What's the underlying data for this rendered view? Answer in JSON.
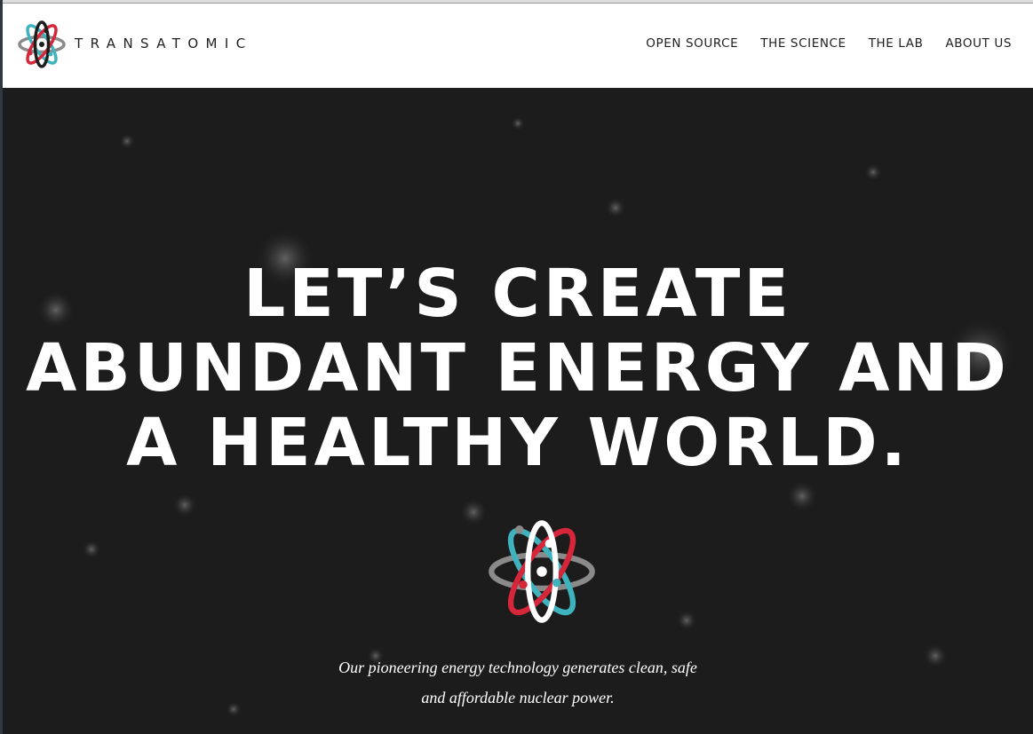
{
  "header": {
    "brand": "TRANSATOMIC",
    "nav": [
      {
        "label": "OPEN SOURCE"
      },
      {
        "label": "THE SCIENCE"
      },
      {
        "label": "THE LAB"
      },
      {
        "label": "ABOUT US"
      }
    ]
  },
  "hero": {
    "headline": [
      "LET’S CREATE",
      "ABUNDANT ENERGY AND",
      "A HEALTHY WORLD."
    ],
    "tagline": [
      "Our pioneering energy technology generates clean, safe",
      "and affordable nuclear power."
    ]
  },
  "icons": {
    "brand_logo": "atom-logo-icon",
    "hero_logo": "atom-logo-icon"
  },
  "colors": {
    "logo_teal": "#3fb3bd",
    "logo_red": "#d6263a",
    "logo_gray": "#8a8a8a",
    "hero_bg": "#1b1b1b",
    "text_dark": "#1e1e1e"
  }
}
